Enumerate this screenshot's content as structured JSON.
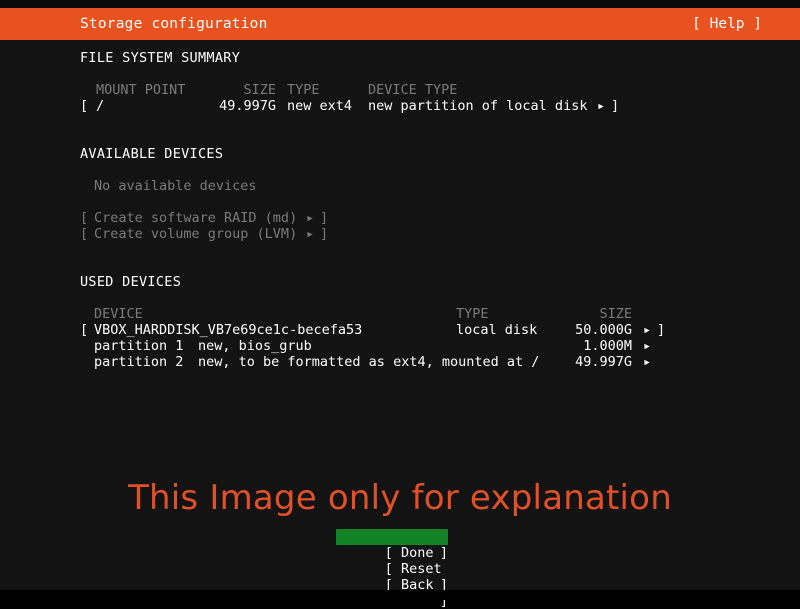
{
  "header": {
    "title": "Storage configuration",
    "help_label": "[ Help ]"
  },
  "colors": {
    "accent_orange": "#e8521f",
    "selected_green": "#118326",
    "background": "#131313",
    "text_bright": "#ffffff",
    "text_dim": "#7a7a7a",
    "watermark": "#e0512a"
  },
  "filesystem_summary": {
    "section_title": "FILE SYSTEM SUMMARY",
    "columns": {
      "mount_point": "MOUNT POINT",
      "size": "SIZE",
      "type": "TYPE",
      "device_type": "DEVICE TYPE"
    },
    "rows": [
      {
        "open_bracket": "[",
        "mount_point": "/",
        "size": "49.997G",
        "type": "new ext4",
        "device_type": "new partition of local disk",
        "arrow": "▸",
        "close_bracket": "]"
      }
    ]
  },
  "available_devices": {
    "section_title": "AVAILABLE DEVICES",
    "empty_message": "No available devices",
    "actions": [
      {
        "open_bracket": "[",
        "label": "Create software RAID (md)",
        "arrow": "▸",
        "close_bracket": "]"
      },
      {
        "open_bracket": "[",
        "label": "Create volume group (LVM)",
        "arrow": "▸",
        "close_bracket": "]"
      }
    ]
  },
  "used_devices": {
    "section_title": "USED DEVICES",
    "columns": {
      "device": "DEVICE",
      "type": "TYPE",
      "size": "SIZE"
    },
    "rows": [
      {
        "open_bracket": "[",
        "device": "VBOX_HARDDISK_VB7e69ce1c-becefa53",
        "type": "local disk",
        "size": "50.000G",
        "arrow": "▸",
        "close_bracket": "]"
      },
      {
        "open_bracket": "",
        "device": "partition 1",
        "type": "new, bios_grub",
        "size": "1.000M",
        "arrow": "▸",
        "close_bracket": ""
      },
      {
        "open_bracket": "",
        "device": "partition 2",
        "type": "new, to be formatted as ext4, mounted at /",
        "size": "49.997G",
        "arrow": "▸",
        "close_bracket": ""
      }
    ]
  },
  "watermark": {
    "text": "This Image only for explanation"
  },
  "buttons": [
    {
      "label": "[ Done",
      "close": "]",
      "selected": true
    },
    {
      "label": "[ Reset",
      "close": "]",
      "selected": false
    },
    {
      "label": "[ Back",
      "close": "]",
      "selected": false
    }
  ]
}
